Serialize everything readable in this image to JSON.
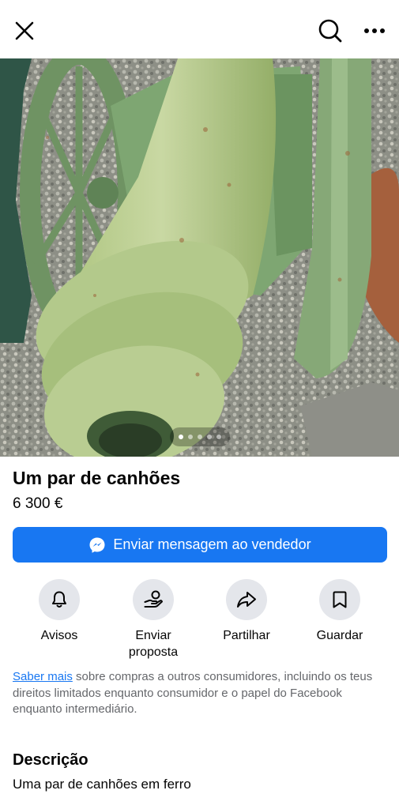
{
  "header": {
    "icons": [
      "close-icon",
      "search-icon",
      "more-icon"
    ]
  },
  "photo": {
    "alt": "cannon photo",
    "slide_count": 5,
    "active_slide": 1
  },
  "listing": {
    "title": "Um par de canhões",
    "price": "6 300 €"
  },
  "message_button": {
    "label": "Enviar mensagem ao vendedor",
    "icon": "messenger-icon"
  },
  "actions": [
    {
      "label": "Avisos",
      "icon": "bell-icon"
    },
    {
      "label": "Enviar proposta",
      "icon": "offer-icon"
    },
    {
      "label": "Partilhar",
      "icon": "share-icon"
    },
    {
      "label": "Guardar",
      "icon": "bookmark-icon"
    }
  ],
  "info": {
    "link": "Saber mais",
    "text": " sobre compras a outros consumidores, incluindo os teus direitos limitados enquanto consumidor e o papel do Facebook enquanto intermediário."
  },
  "description": {
    "heading": "Descrição",
    "text": "Uma par de canhões em ferro"
  },
  "colors": {
    "accent": "#1877f2",
    "icon_circle": "#e4e6eb",
    "secondary_text": "#65676b"
  }
}
